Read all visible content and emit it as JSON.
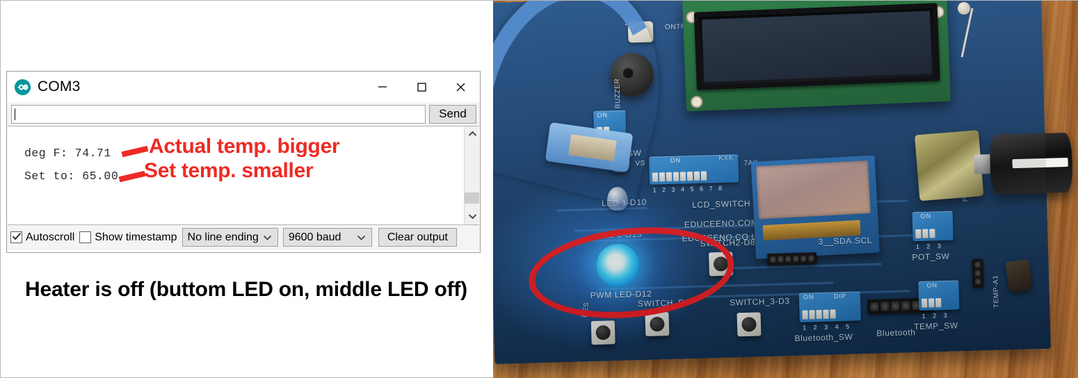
{
  "window": {
    "title": "COM3",
    "icon": "arduino-logo-icon",
    "controls": {
      "minimize": "minimize-icon",
      "maximize": "maximize-icon",
      "close": "close-icon"
    }
  },
  "input_row": {
    "value": "",
    "placeholder": "",
    "send_label": "Send"
  },
  "output": {
    "lines": [
      "deg F: 74.71",
      "Set to: 65.00"
    ],
    "text": "deg F: 74.71\nSet to: 65.00",
    "scrollbar": {
      "up_icon": "chevron-up-icon",
      "down_icon": "chevron-down-icon"
    }
  },
  "toolbar": {
    "autoscroll_label": "Autoscroll",
    "autoscroll_checked": true,
    "show_timestamp_label": "Show timestamp",
    "show_timestamp_checked": false,
    "line_ending_value": "No line ending",
    "baud_value": "9600 baud",
    "clear_output_label": "Clear output"
  },
  "annotations": {
    "actual_temp": "Actual temp. bigger",
    "set_temp": "Set temp. smaller",
    "color": "#ee2a24",
    "highlight_shape": "red-ellipse"
  },
  "caption": {
    "text": "Heater is off (buttom LED on, middle LED off)"
  },
  "photo": {
    "description": "arduino-shield-board-photo",
    "silkscreen": [
      "BUZZER",
      "ONTRA",
      "BUZZER_SW",
      "VS",
      "ON",
      "KXK",
      "7AK",
      "LED 1-D10",
      "LCD_SWITCH",
      "EDUCEENO.COM",
      "EDUCEENO.CO.UK",
      "LED 1-D13",
      "SWITCH2-D8",
      "PWM LED-D12",
      "SWITCH_D9",
      "SWITCH_3-D3",
      "RES",
      "3__SDA.SCL",
      "POT_SW",
      "ON",
      "DIP",
      "Bluetooth_SW",
      "Bluetooth",
      "TEMP_SW",
      "TEMP-A1",
      "PO"
    ],
    "dip_numbers_8": "1 2 3 4 5 6 7 8",
    "dip_numbers_5": "1 2 3 4 5",
    "dip_numbers_3": "1 2 3",
    "dip_numbers_2": "1 2"
  },
  "colors": {
    "annotation_red": "#ee2a24",
    "arduino_teal": "#00979d",
    "led_blue": "#45d8ff",
    "pcb_blue": "#1b4476",
    "wood": "#bb7b3d"
  }
}
